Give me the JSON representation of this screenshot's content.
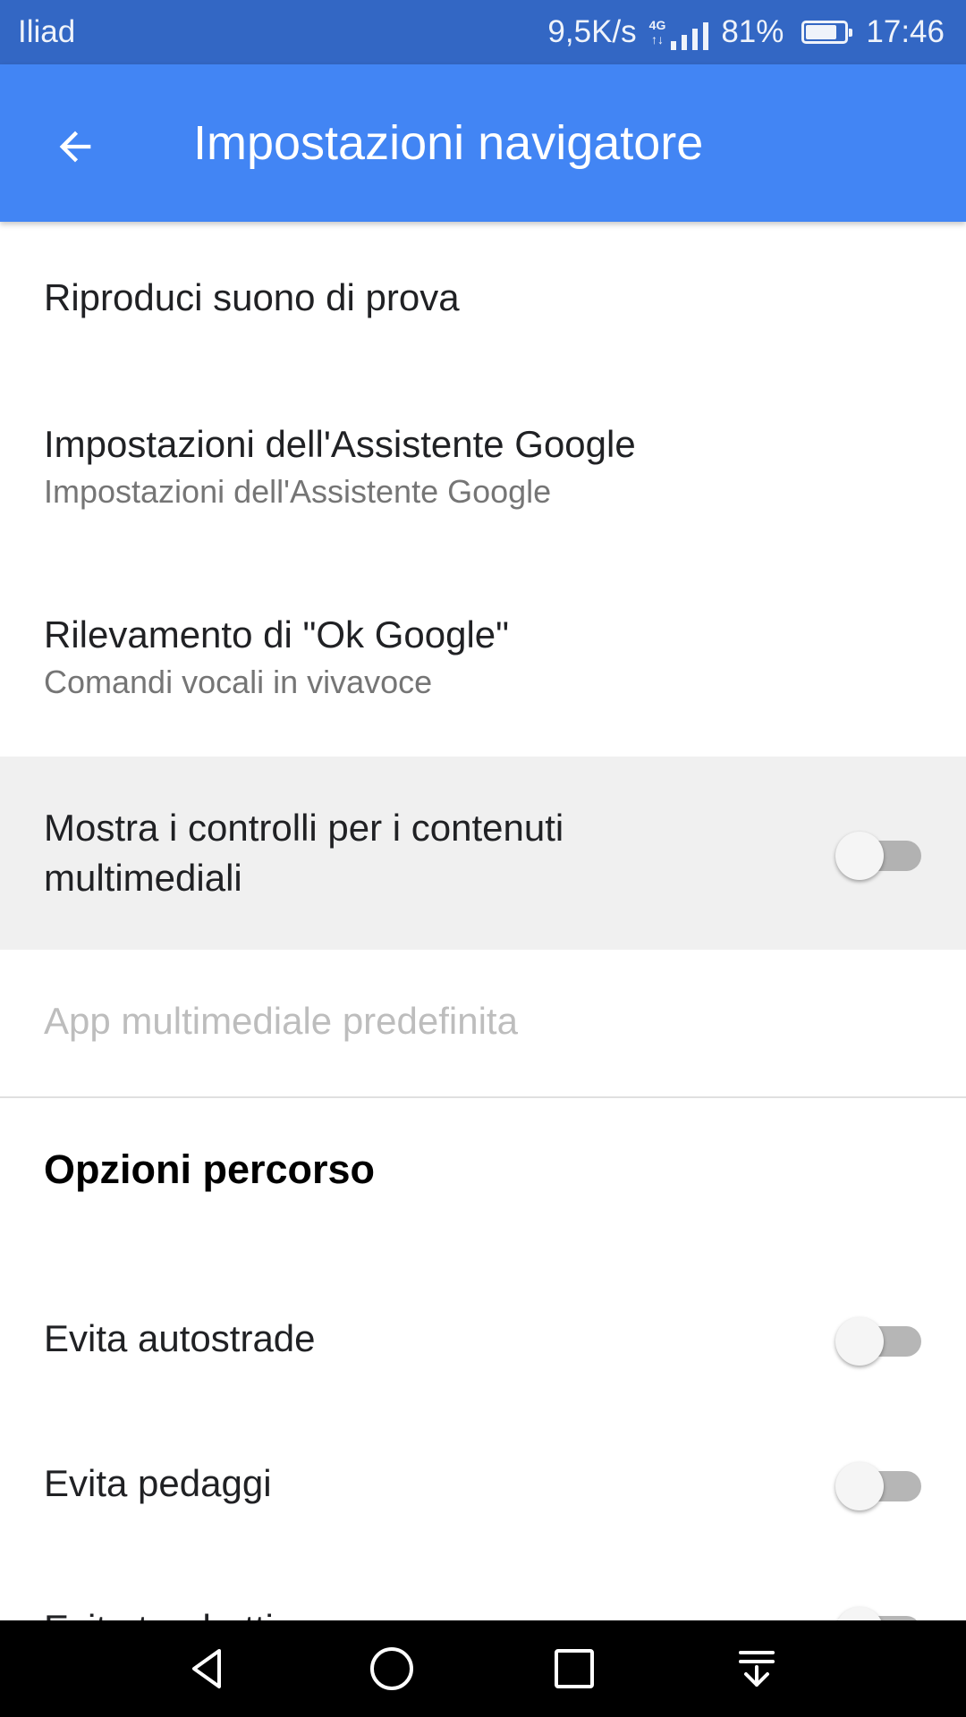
{
  "status_bar": {
    "carrier": "Iliad",
    "speed": "9,5K/s",
    "network_tag_top": "4G",
    "network_tag_bottom": "↑↓",
    "battery_level": 81,
    "battery_text": "81%",
    "time": "17:46",
    "icons": [
      "signal-icon",
      "battery-icon"
    ]
  },
  "app_bar": {
    "title": "Impostazioni navigatore",
    "back_icon": "arrow-back-icon",
    "color": "#4285f4"
  },
  "settings": {
    "test_sound": {
      "label": "Riproduci suono di prova"
    },
    "assistant": {
      "label": "Impostazioni dell'Assistente Google",
      "subtitle": "Impostazioni dell'Assistente Google"
    },
    "ok_google": {
      "label": "Rilevamento di \"Ok Google\"",
      "subtitle": "Comandi vocali in vivavoce"
    },
    "media_controls": {
      "label": "Mostra i controlli per i contenuti multimediali",
      "enabled": false
    },
    "default_media_app": {
      "label": "App multimediale predefinita",
      "disabled": true
    }
  },
  "route_options": {
    "title": "Opzioni percorso",
    "items": [
      {
        "label": "Evita autostrade",
        "enabled": false
      },
      {
        "label": "Evita pedaggi",
        "enabled": false
      },
      {
        "label": "Evita traghetti",
        "enabled": false
      }
    ]
  },
  "nav_bar": {
    "icons": [
      "back-triangle-icon",
      "home-circle-icon",
      "recents-square-icon",
      "notification-pull-icon"
    ]
  }
}
